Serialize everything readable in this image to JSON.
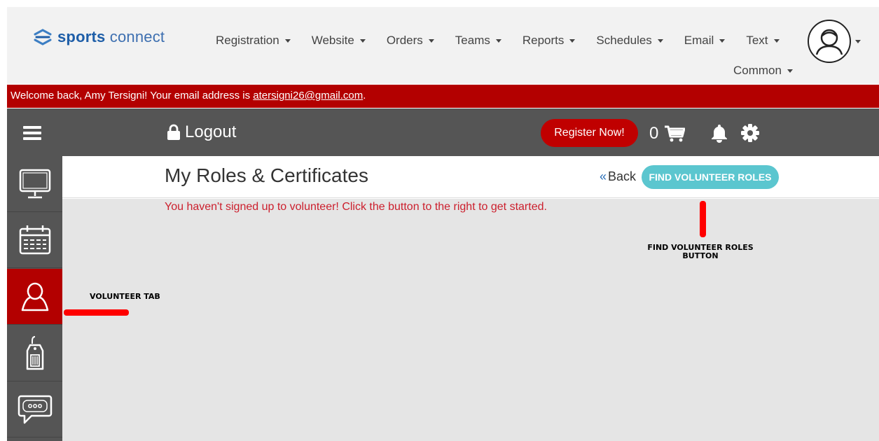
{
  "brand": {
    "name_bold": "sports",
    "name_light": "connect"
  },
  "nav": {
    "items": [
      {
        "label": "Registration"
      },
      {
        "label": "Website"
      },
      {
        "label": "Orders"
      },
      {
        "label": "Teams"
      },
      {
        "label": "Reports"
      },
      {
        "label": "Schedules"
      },
      {
        "label": "Email"
      },
      {
        "label": "Text"
      },
      {
        "label": "Common"
      }
    ]
  },
  "welcome": {
    "prefix": "Welcome back, Amy Tersigni! Your email address is ",
    "email": "atersigni26@gmail.com",
    "suffix": "."
  },
  "toolbar": {
    "logout_label": "Logout",
    "register_label": "Register Now!",
    "cart_count": "0"
  },
  "sidebar": {
    "items": [
      {
        "icon": "monitor-icon"
      },
      {
        "icon": "calendar-icon"
      },
      {
        "icon": "person-icon",
        "active": true
      },
      {
        "icon": "tag-icon"
      },
      {
        "icon": "chat-icon"
      }
    ]
  },
  "page": {
    "title": "My Roles & Certificates",
    "back_label": "Back",
    "find_button": "FIND VOLUNTEER ROLES",
    "empty_message": "You haven't signed up to volunteer! Click the button to the right to get started."
  },
  "annotations": {
    "find_line1": "FIND VOLUNTEER ROLES",
    "find_line2": "BUTTON",
    "volunteer_tab": "VOLUNTEER TAB"
  },
  "colors": {
    "accent_red": "#b30000",
    "toolbar_gray": "#555555",
    "teal_button": "#5bc6cf",
    "brand_blue": "#1e5ea8"
  }
}
